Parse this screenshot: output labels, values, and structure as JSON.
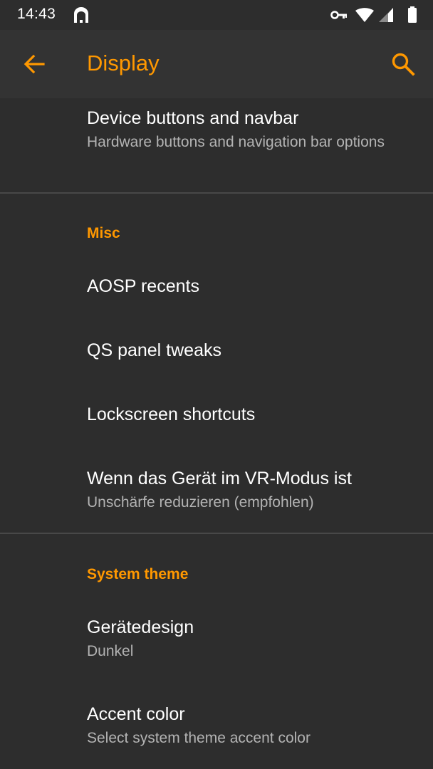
{
  "status_bar": {
    "time": "14:43",
    "icons": [
      "notification-icon",
      "vpn-key-icon",
      "wifi-icon",
      "cell-signal-icon",
      "battery-icon"
    ]
  },
  "app_bar": {
    "title": "Display",
    "back_icon": "arrow-back-icon",
    "search_icon": "search-icon",
    "accent_color": "#ff9800"
  },
  "sections": {
    "top": {
      "items": [
        {
          "title": "Device buttons and navbar",
          "summary": "Hardware buttons and navigation bar options"
        }
      ]
    },
    "misc": {
      "header": "Misc",
      "items": [
        {
          "title": "AOSP recents"
        },
        {
          "title": "QS panel tweaks"
        },
        {
          "title": "Lockscreen shortcuts"
        },
        {
          "title": "Wenn das Gerät im VR-Modus ist",
          "summary": "Unschärfe reduzieren (empfohlen)"
        }
      ]
    },
    "system_theme": {
      "header": "System theme",
      "items": [
        {
          "title": "Gerätedesign",
          "summary": "Dunkel"
        },
        {
          "title": "Accent color",
          "summary": "Select system theme accent color"
        }
      ]
    }
  }
}
